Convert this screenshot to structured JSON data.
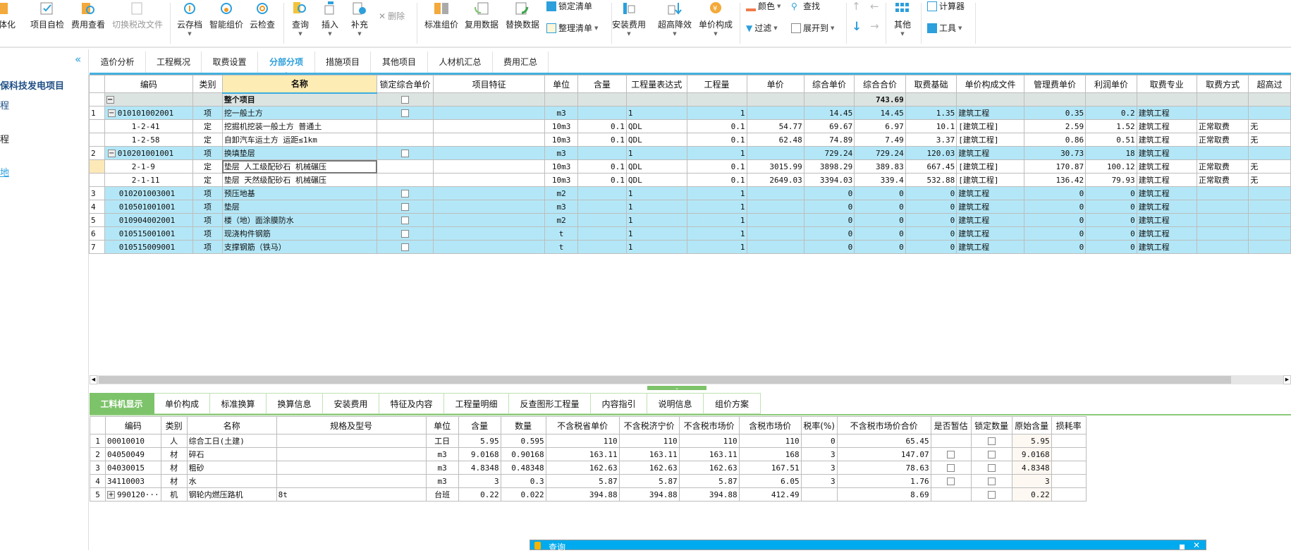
{
  "toolbar": {
    "buttons": [
      {
        "label": "体化",
        "icon": "integrate-icon"
      },
      {
        "label": "项目自检",
        "icon": "project-check-icon"
      },
      {
        "label": "费用查看",
        "icon": "cost-view-icon"
      },
      {
        "label": "切换税改文件",
        "icon": "tax-switch-icon"
      },
      {
        "label": "云存档",
        "icon": "cloud-save-icon"
      },
      {
        "label": "智能组价",
        "icon": "smart-pricing-icon"
      },
      {
        "label": "云检查",
        "icon": "cloud-check-icon"
      },
      {
        "label": "查询",
        "icon": "query-icon"
      },
      {
        "label": "插入",
        "icon": "insert-icon"
      },
      {
        "label": "补充",
        "icon": "supplement-icon"
      },
      {
        "label": "标准组价",
        "icon": "standard-pricing-icon"
      },
      {
        "label": "复用数据",
        "icon": "reuse-data-icon"
      },
      {
        "label": "替换数据",
        "icon": "replace-data-icon"
      },
      {
        "label": "安装费用",
        "icon": "install-cost-icon"
      },
      {
        "label": "超高降效",
        "icon": "height-efficiency-icon"
      },
      {
        "label": "单价构成",
        "icon": "unit-price-icon"
      },
      {
        "label": "其他",
        "icon": "other-icon"
      }
    ],
    "small": {
      "delete": "删除",
      "lock_list": "锁定清单",
      "organize_list": "整理清单",
      "color": "颜色",
      "find": "查找",
      "filter": "过滤",
      "expand_to": "展开到",
      "calculator": "计算器",
      "tools": "工具"
    }
  },
  "sidebar": {
    "project": "保科技发电项目",
    "item1": "程",
    "item2": "程",
    "item3": "地"
  },
  "tabs": [
    "造价分析",
    "工程概况",
    "取费设置",
    "分部分项",
    "措施项目",
    "其他项目",
    "人材机汇总",
    "费用汇总"
  ],
  "active_tab": 3,
  "main_grid": {
    "columns": [
      "",
      "编码",
      "类别",
      "名称",
      "锁定综合单价",
      "项目特征",
      "单位",
      "含量",
      "工程量表达式",
      "工程量",
      "单价",
      "综合单价",
      "综合合价",
      "取费基础",
      "单价构成文件",
      "管理费单价",
      "利润单价",
      "取费专业",
      "取费方式",
      "超高过"
    ],
    "rows": [
      {
        "kind": "total",
        "num": "",
        "toggle": "−",
        "code": "",
        "type": "",
        "name": "整个项目",
        "lock": false,
        "feature": "",
        "unit": "",
        "content": "",
        "expr": "",
        "qty": "",
        "price": "",
        "cprice": "",
        "ctotal": "743.69",
        "base": "",
        "file": "",
        "mgmt": "",
        "profit": "",
        "major": "",
        "method": "",
        "over": ""
      },
      {
        "kind": "qd",
        "num": "1",
        "toggle": "−",
        "code": "010101002001",
        "type": "项",
        "name": "挖一般土方",
        "lock": false,
        "feature": "",
        "unit": "m3",
        "content": "",
        "expr": "1",
        "qty": "1",
        "price": "",
        "cprice": "14.45",
        "ctotal": "14.45",
        "base": "1.35",
        "file": "建筑工程",
        "mgmt": "0.35",
        "profit": "0.2",
        "major": "建筑工程",
        "method": "",
        "over": ""
      },
      {
        "kind": "de",
        "num": "",
        "code": "1-2-41",
        "type": "定",
        "name": "挖掘机挖装一般土方 普通土",
        "feature": "",
        "unit": "10m3",
        "content": "0.1",
        "expr": "QDL",
        "qty": "0.1",
        "price": "54.77",
        "cprice": "69.67",
        "ctotal": "6.97",
        "base": "10.1",
        "file": "[建筑工程]",
        "mgmt": "2.59",
        "profit": "1.52",
        "major": "建筑工程",
        "method": "正常取费",
        "over": "无"
      },
      {
        "kind": "de",
        "num": "",
        "code": "1-2-58",
        "type": "定",
        "name": "自卸汽车运土方 运距≤1km",
        "feature": "",
        "unit": "10m3",
        "content": "0.1",
        "expr": "QDL",
        "qty": "0.1",
        "price": "62.48",
        "cprice": "74.89",
        "ctotal": "7.49",
        "base": "3.37",
        "file": "[建筑工程]",
        "mgmt": "0.86",
        "profit": "0.51",
        "major": "建筑工程",
        "method": "正常取费",
        "over": "无"
      },
      {
        "kind": "qd",
        "num": "2",
        "toggle": "−",
        "code": "010201001001",
        "type": "项",
        "name": "换填垫层",
        "lock": false,
        "feature": "",
        "unit": "m3",
        "content": "",
        "expr": "1",
        "qty": "1",
        "price": "",
        "cprice": "729.24",
        "ctotal": "729.24",
        "base": "120.03",
        "file": "建筑工程",
        "mgmt": "30.73",
        "profit": "18",
        "major": "建筑工程",
        "method": "",
        "over": ""
      },
      {
        "kind": "de",
        "selected": true,
        "num": "",
        "code": "2-1-9",
        "type": "定",
        "name": "垫层 人工级配砂石 机械碾压",
        "feature": "",
        "unit": "10m3",
        "content": "0.1",
        "expr": "QDL",
        "qty": "0.1",
        "price": "3015.99",
        "cprice": "3898.29",
        "ctotal": "389.83",
        "base": "667.45",
        "file": "[建筑工程]",
        "mgmt": "170.87",
        "profit": "100.12",
        "major": "建筑工程",
        "method": "正常取费",
        "over": "无"
      },
      {
        "kind": "de",
        "num": "",
        "code": "2-1-11",
        "type": "定",
        "name": "垫层 天然级配砂石 机械碾压",
        "feature": "",
        "unit": "10m3",
        "content": "0.1",
        "expr": "QDL",
        "qty": "0.1",
        "price": "2649.03",
        "cprice": "3394.03",
        "ctotal": "339.4",
        "base": "532.88",
        "file": "[建筑工程]",
        "mgmt": "136.42",
        "profit": "79.93",
        "major": "建筑工程",
        "method": "正常取费",
        "over": "无"
      },
      {
        "kind": "qd",
        "num": "3",
        "code": "010201003001",
        "type": "项",
        "name": "预压地基",
        "lock": false,
        "feature": "",
        "unit": "m2",
        "content": "",
        "expr": "1",
        "qty": "1",
        "price": "",
        "cprice": "0",
        "ctotal": "0",
        "base": "0",
        "file": "建筑工程",
        "mgmt": "0",
        "profit": "0",
        "major": "建筑工程",
        "method": "",
        "over": ""
      },
      {
        "kind": "qd",
        "num": "4",
        "code": "010501001001",
        "type": "项",
        "name": "垫层",
        "lock": false,
        "feature": "",
        "unit": "m3",
        "content": "",
        "expr": "1",
        "qty": "1",
        "price": "",
        "cprice": "0",
        "ctotal": "0",
        "base": "0",
        "file": "建筑工程",
        "mgmt": "0",
        "profit": "0",
        "major": "建筑工程",
        "method": "",
        "over": ""
      },
      {
        "kind": "qd",
        "num": "5",
        "code": "010904002001",
        "type": "项",
        "name": "楼（地）面涂膜防水",
        "lock": false,
        "feature": "",
        "unit": "m2",
        "content": "",
        "expr": "1",
        "qty": "1",
        "price": "",
        "cprice": "0",
        "ctotal": "0",
        "base": "0",
        "file": "建筑工程",
        "mgmt": "0",
        "profit": "0",
        "major": "建筑工程",
        "method": "",
        "over": ""
      },
      {
        "kind": "qd",
        "num": "6",
        "code": "010515001001",
        "type": "项",
        "name": "现浇构件钢筋",
        "lock": false,
        "feature": "",
        "unit": "t",
        "content": "",
        "expr": "1",
        "qty": "1",
        "price": "",
        "cprice": "0",
        "ctotal": "0",
        "base": "0",
        "file": "建筑工程",
        "mgmt": "0",
        "profit": "0",
        "major": "建筑工程",
        "method": "",
        "over": ""
      },
      {
        "kind": "qd",
        "num": "7",
        "code": "010515009001",
        "type": "项",
        "name": "支撑钢筋（铁马）",
        "lock": false,
        "feature": "",
        "unit": "t",
        "content": "",
        "expr": "1",
        "qty": "1",
        "price": "",
        "cprice": "0",
        "ctotal": "0",
        "base": "0",
        "file": "建筑工程",
        "mgmt": "0",
        "profit": "0",
        "major": "建筑工程",
        "method": "",
        "over": ""
      }
    ]
  },
  "bottom_tabs": [
    "工料机显示",
    "单价构成",
    "标准换算",
    "换算信息",
    "安装费用",
    "特征及内容",
    "工程量明细",
    "反查图形工程量",
    "内容指引",
    "说明信息",
    "组价方案"
  ],
  "bottom_active_tab": 0,
  "sub_grid": {
    "columns": [
      "",
      "编码",
      "类别",
      "名称",
      "规格及型号",
      "单位",
      "含量",
      "数量",
      "不含税省单价",
      "不含税济宁价",
      "不含税市场价",
      "含税市场价",
      "税率(%)",
      "不含税市场价合价",
      "是否暂估",
      "锁定数量",
      "原始含量",
      "损耗率"
    ],
    "rows": [
      {
        "num": "1",
        "code": "00010010",
        "type": "人",
        "name": "综合工日(土建)",
        "spec": "",
        "unit": "工日",
        "content": "5.95",
        "qty": "0.595",
        "prov": "110",
        "jining": "110",
        "market": "110",
        "taxmarket": "110",
        "rate": "0",
        "total": "65.45",
        "est": null,
        "lock": false,
        "orig": "5.95",
        "loss": ""
      },
      {
        "num": "2",
        "code": "04050049",
        "type": "材",
        "name": "碎石",
        "spec": "",
        "unit": "m3",
        "content": "9.0168",
        "qty": "0.90168",
        "prov": "163.11",
        "jining": "163.11",
        "market": "163.11",
        "taxmarket": "168",
        "rate": "3",
        "total": "147.07",
        "est": false,
        "lock": false,
        "orig": "9.0168",
        "loss": ""
      },
      {
        "num": "3",
        "code": "04030015",
        "type": "材",
        "name": "粗砂",
        "spec": "",
        "unit": "m3",
        "content": "4.8348",
        "qty": "0.48348",
        "prov": "162.63",
        "jining": "162.63",
        "market": "162.63",
        "taxmarket": "167.51",
        "rate": "3",
        "total": "78.63",
        "est": false,
        "lock": false,
        "orig": "4.8348",
        "loss": ""
      },
      {
        "num": "4",
        "code": "34110003",
        "type": "材",
        "name": "水",
        "spec": "",
        "unit": "m3",
        "content": "3",
        "qty": "0.3",
        "prov": "5.87",
        "jining": "5.87",
        "market": "5.87",
        "taxmarket": "6.05",
        "rate": "3",
        "total": "1.76",
        "est": false,
        "lock": false,
        "orig": "3",
        "loss": ""
      },
      {
        "num": "5",
        "toggle": "+",
        "code": "990120···",
        "type": "机",
        "name": "钢轮内燃压路机",
        "spec": "8t",
        "unit": "台班",
        "content": "0.22",
        "qty": "0.022",
        "prov": "394.88",
        "jining": "394.88",
        "market": "394.88",
        "taxmarket": "412.49",
        "rate": "",
        "total": "8.69",
        "est": null,
        "lock": false,
        "orig": "0.22",
        "loss": ""
      }
    ]
  },
  "dialog": {
    "title": "查询"
  },
  "colors": {
    "accent": "#2c9fdc",
    "row_highlight": "#b3e7f7",
    "active_bottom_tab": "#7dc36a",
    "dialog": "#00aaee"
  }
}
